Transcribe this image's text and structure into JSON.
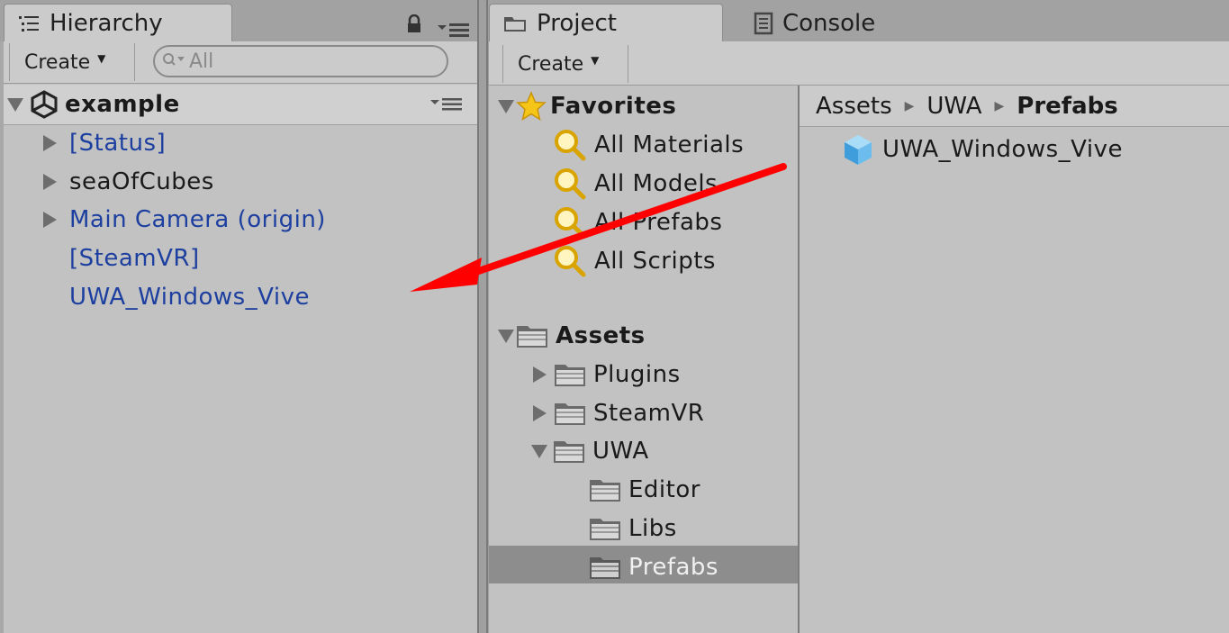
{
  "hierarchy": {
    "tab_label": "Hierarchy",
    "create_label": "Create",
    "search_placeholder": "All",
    "scene_name": "example",
    "items": [
      {
        "label": "[Status]",
        "expandable": true
      },
      {
        "label": "seaOfCubes",
        "expandable": true
      },
      {
        "label": "Main Camera (origin)",
        "expandable": true
      },
      {
        "label": "[SteamVR]",
        "expandable": false
      },
      {
        "label": "UWA_Windows_Vive",
        "expandable": false
      }
    ]
  },
  "project": {
    "tab_label": "Project",
    "console_tab_label": "Console",
    "create_label": "Create",
    "favorites": {
      "label": "Favorites",
      "items": [
        "All Materials",
        "All Models",
        "All Prefabs",
        "All Scripts"
      ]
    },
    "assets": {
      "label": "Assets",
      "items": [
        {
          "label": "Plugins",
          "level": 1,
          "state": "collapsed"
        },
        {
          "label": "SteamVR",
          "level": 1,
          "state": "collapsed"
        },
        {
          "label": "UWA",
          "level": 1,
          "state": "expanded"
        },
        {
          "label": "Editor",
          "level": 2,
          "state": "none"
        },
        {
          "label": "Libs",
          "level": 2,
          "state": "none"
        },
        {
          "label": "Prefabs",
          "level": 2,
          "state": "selected"
        }
      ]
    },
    "breadcrumb": [
      "Assets",
      "UWA",
      "Prefabs"
    ],
    "content_items": [
      "UWA_Windows_Vive"
    ]
  },
  "colors": {
    "annotation_arrow": "#ff0000",
    "scene_object_blue": "#1c3fa0",
    "selection": "#8d8d8d"
  }
}
